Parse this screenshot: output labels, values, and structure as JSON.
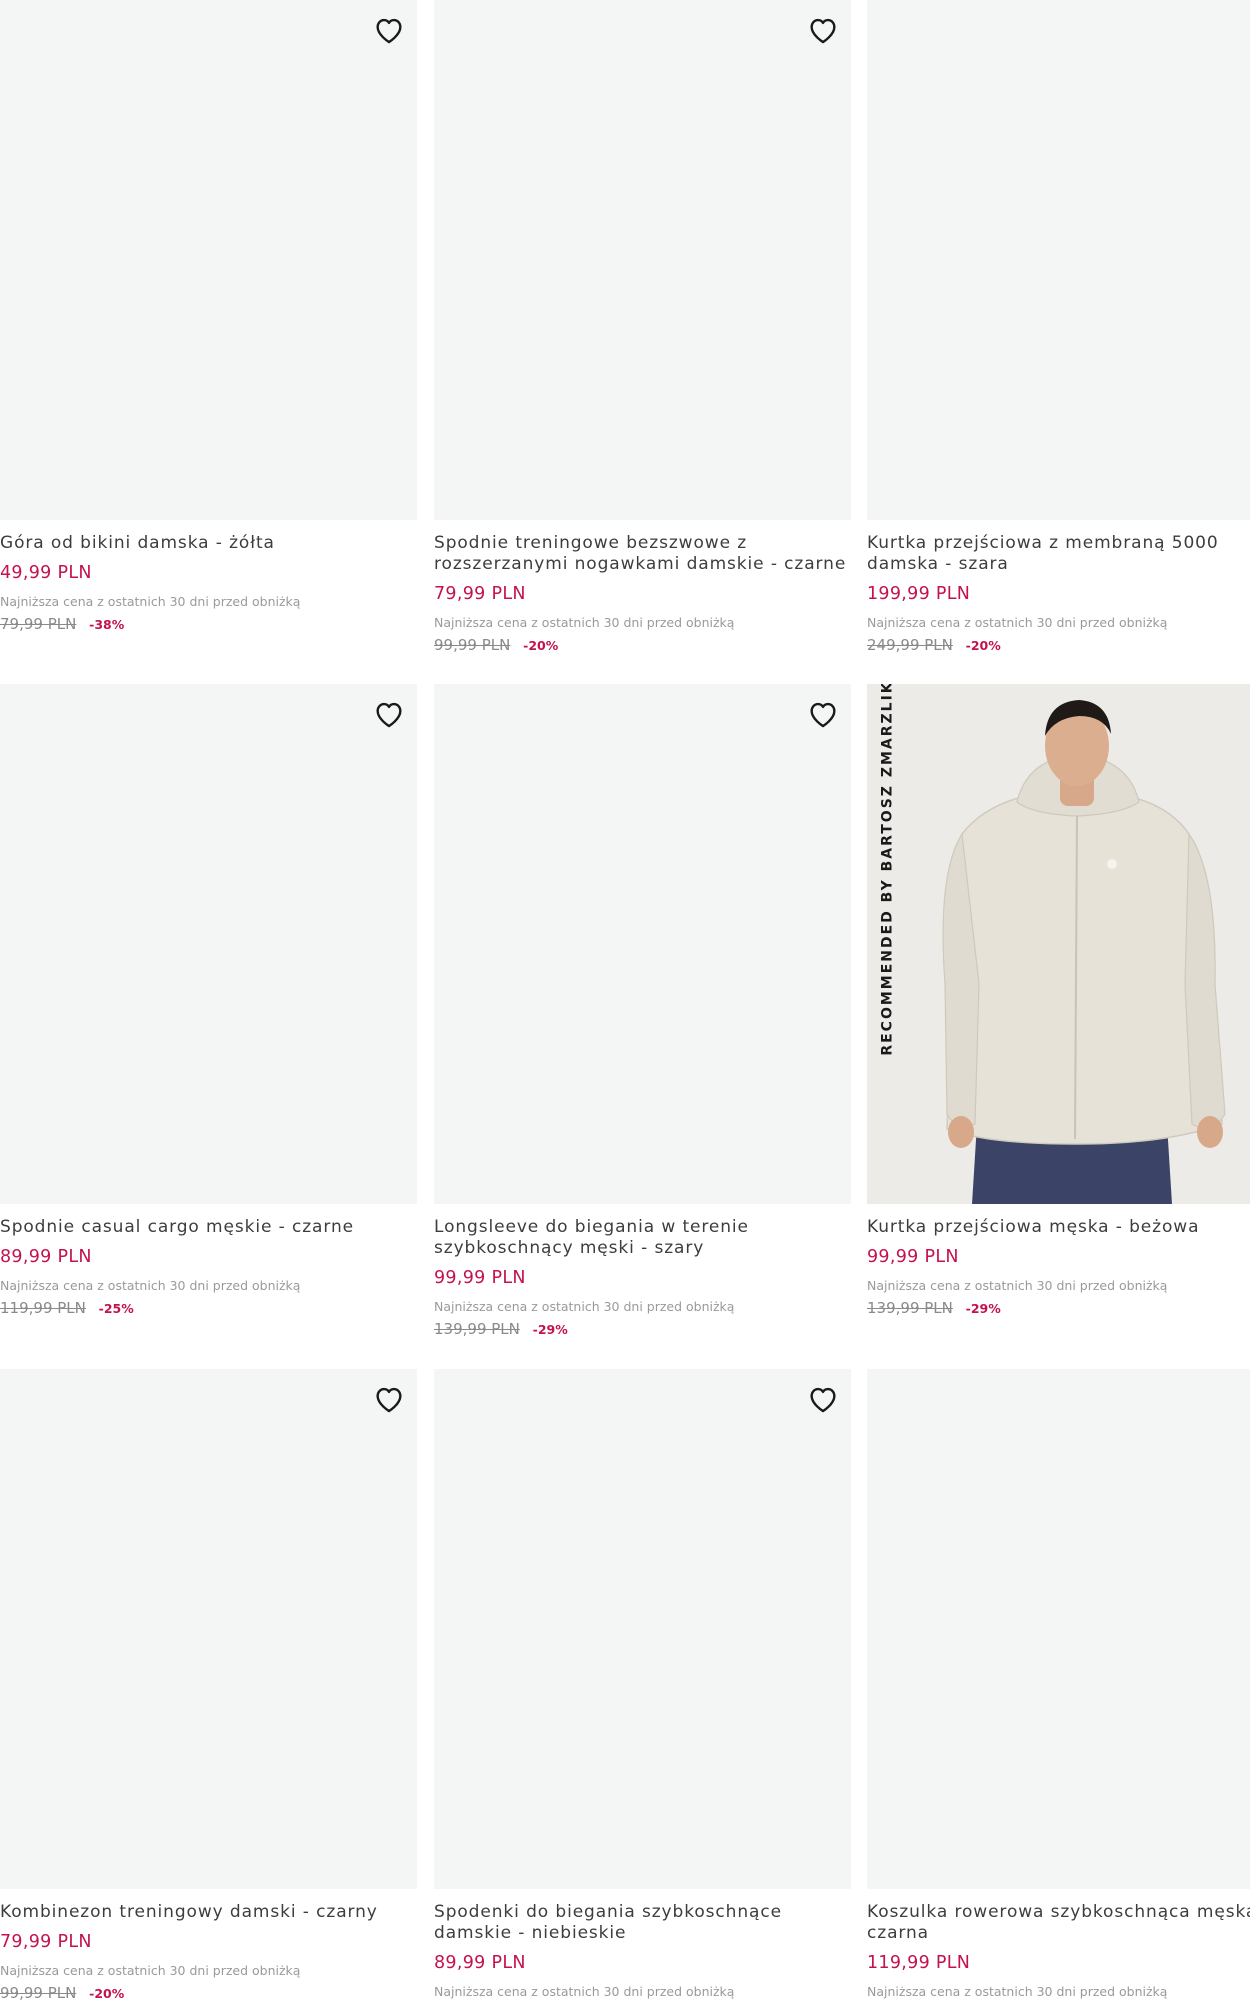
{
  "products": [
    {
      "name": "Góra od bikini damska - żółta",
      "price": "49,99 PLN",
      "lowest_label": "Najniższa cena z ostatnich 30 dni przed obniżką",
      "old_price": "79,99 PLN",
      "discount": "-38%"
    },
    {
      "name": "Spodnie treningowe bezszwowe z rozszerzanymi nogawkami damskie - czarne",
      "price": "79,99 PLN",
      "lowest_label": "Najniższa cena z ostatnich 30 dni przed obniżką",
      "old_price": "99,99 PLN",
      "discount": "-20%"
    },
    {
      "name": "Kurtka przejściowa z membraną 5000 damska - szara",
      "price": "199,99 PLN",
      "lowest_label": "Najniższa cena z ostatnich 30 dni przed obniżką",
      "old_price": "249,99 PLN",
      "discount": "-20%"
    },
    {
      "name": "Spodnie casual cargo męskie - czarne",
      "price": "89,99 PLN",
      "lowest_label": "Najniższa cena z ostatnich 30 dni przed obniżką",
      "old_price": "119,99 PLN",
      "discount": "-25%"
    },
    {
      "name": "Longsleeve do biegania w terenie szybkoschnący męski - szary",
      "price": "99,99 PLN",
      "lowest_label": "Najniższa cena z ostatnich 30 dni przed obniżką",
      "old_price": "139,99 PLN",
      "discount": "-29%"
    },
    {
      "name": "Kurtka przejściowa męska - beżowa",
      "price": "99,99 PLN",
      "lowest_label": "Najniższa cena z ostatnich 30 dni przed obniżką",
      "old_price": "139,99 PLN",
      "discount": "-29%",
      "badge": "RECOMMENDED BY BARTOSZ ZMARZLIK"
    },
    {
      "name": "Kombinezon treningowy damski - czarny",
      "price": "79,99 PLN",
      "lowest_label": "Najniższa cena z ostatnich 30 dni przed obniżką",
      "old_price": "99,99 PLN",
      "discount": "-20%"
    },
    {
      "name": "Spodenki do biegania szybkoschnące damskie - niebieskie",
      "price": "89,99 PLN",
      "lowest_label": "Najniższa cena z ostatnich 30 dni przed obniżką"
    },
    {
      "name": "Koszulka rowerowa szybkoschnąca męska - czarna",
      "price": "119,99 PLN",
      "lowest_label": "Najniższa cena z ostatnich 30 dni przed obniżką"
    }
  ],
  "colors": {
    "price": "#c4124f",
    "image_bg": "#f4f6f6"
  },
  "icons": {
    "wishlist": "heart-outline-icon"
  }
}
